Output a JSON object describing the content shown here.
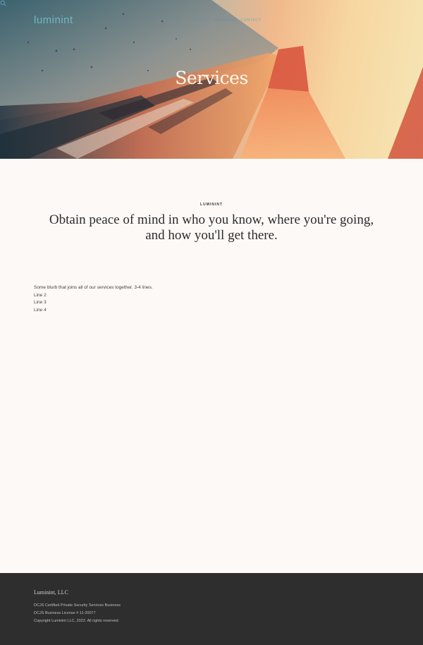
{
  "header": {
    "logo": "luminint",
    "nav": [
      "HOME",
      "ABOUT",
      "SERVICES",
      "CONTACT"
    ],
    "search_icon": "search-icon"
  },
  "hero": {
    "title": "Services"
  },
  "main": {
    "eyebrow": "LUMININT",
    "headline_line1": "Obtain peace of mind in who you know, where you're going,",
    "headline_line2": "and how you'll get there.",
    "blurb": [
      "Some blurb that joins all of our services together. 3-4 lines.",
      "Line 2",
      "Line 3",
      "Line 4"
    ]
  },
  "footer": {
    "brand": "Luminint, LLC",
    "lines": [
      "DCJS Certified Private Security Services Business",
      "DCJS Business License # 11-20077",
      "Copyright Luminint LLC, 2022.  All rights reserved."
    ]
  },
  "colors": {
    "accent": "#6fb6c8",
    "page_bg": "#fdf9f7",
    "footer_bg": "#2e2e2e"
  }
}
